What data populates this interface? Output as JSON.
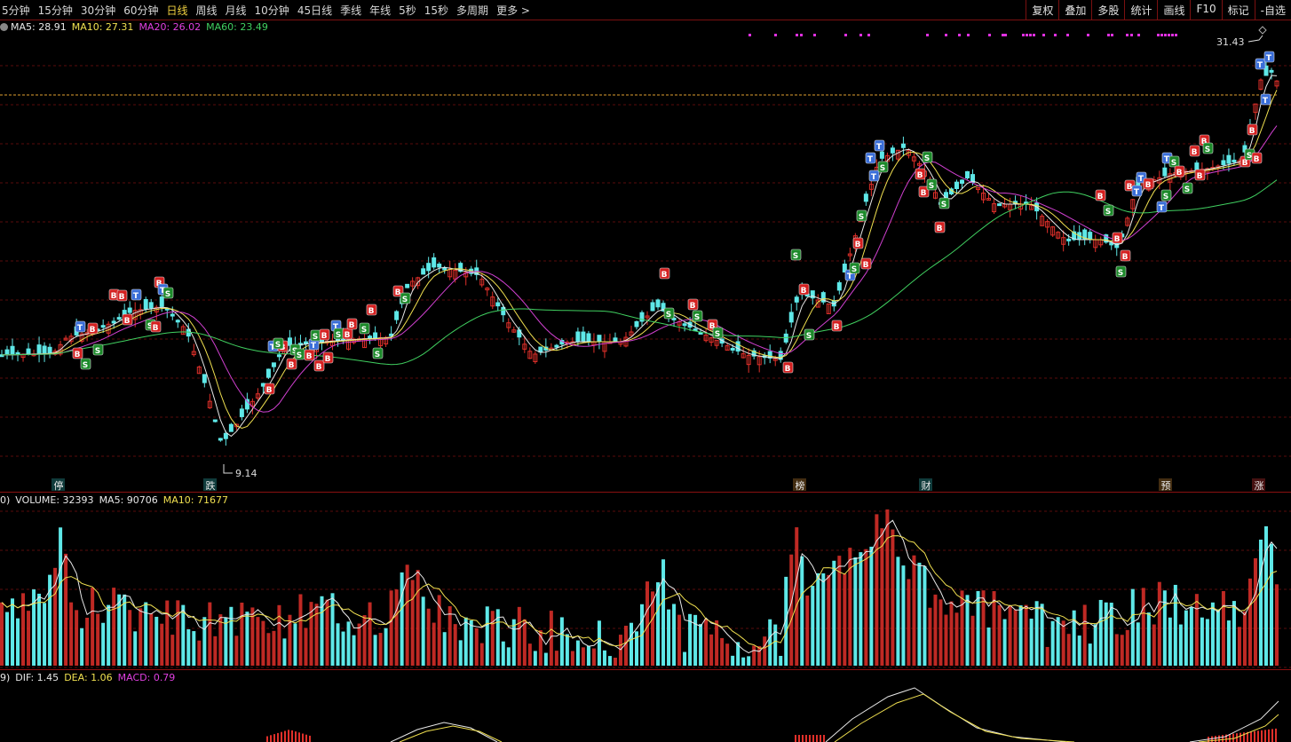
{
  "periods": [
    "5分钟",
    "15分钟",
    "30分钟",
    "60分钟",
    "日线",
    "周线",
    "月线",
    "10分钟",
    "45日线",
    "季线",
    "年线",
    "5秒",
    "15秒",
    "多周期",
    "更多 >"
  ],
  "active_period": "日线",
  "tools": [
    "复权",
    "叠加",
    "多股",
    "统计",
    "画线",
    "F10",
    "标记",
    "-自选"
  ],
  "ma_line": {
    "ma5": "MA5: 28.91",
    "ma10": "MA10: 27.31",
    "ma20": "MA20: 26.02",
    "ma60": "MA60: 23.49"
  },
  "price": {
    "high_label": "31.43",
    "low_label": "9.14"
  },
  "event_tags": [
    "停",
    "跌",
    "榜",
    "财",
    "预",
    "涨"
  ],
  "volume_line": {
    "prefix": "0)",
    "vol": "VOLUME: 32393",
    "ma5": "MA5: 90706",
    "ma10": "MA10: 71677"
  },
  "macd_line": {
    "prefix": "9)",
    "dif": "DIF: 1.45",
    "dea": "DEA: 1.06",
    "macd": "MACD: 0.79"
  },
  "signal_labels": {
    "buy": "B",
    "sell": "S",
    "top": "T"
  },
  "colors": {
    "up": "#e0302a",
    "down": "#5ee8e8",
    "ma5": "#e8e8e8",
    "ma10": "#f0e050",
    "ma20": "#d040d0",
    "ma60": "#40d060",
    "grid": "#5a0c0c"
  }
}
